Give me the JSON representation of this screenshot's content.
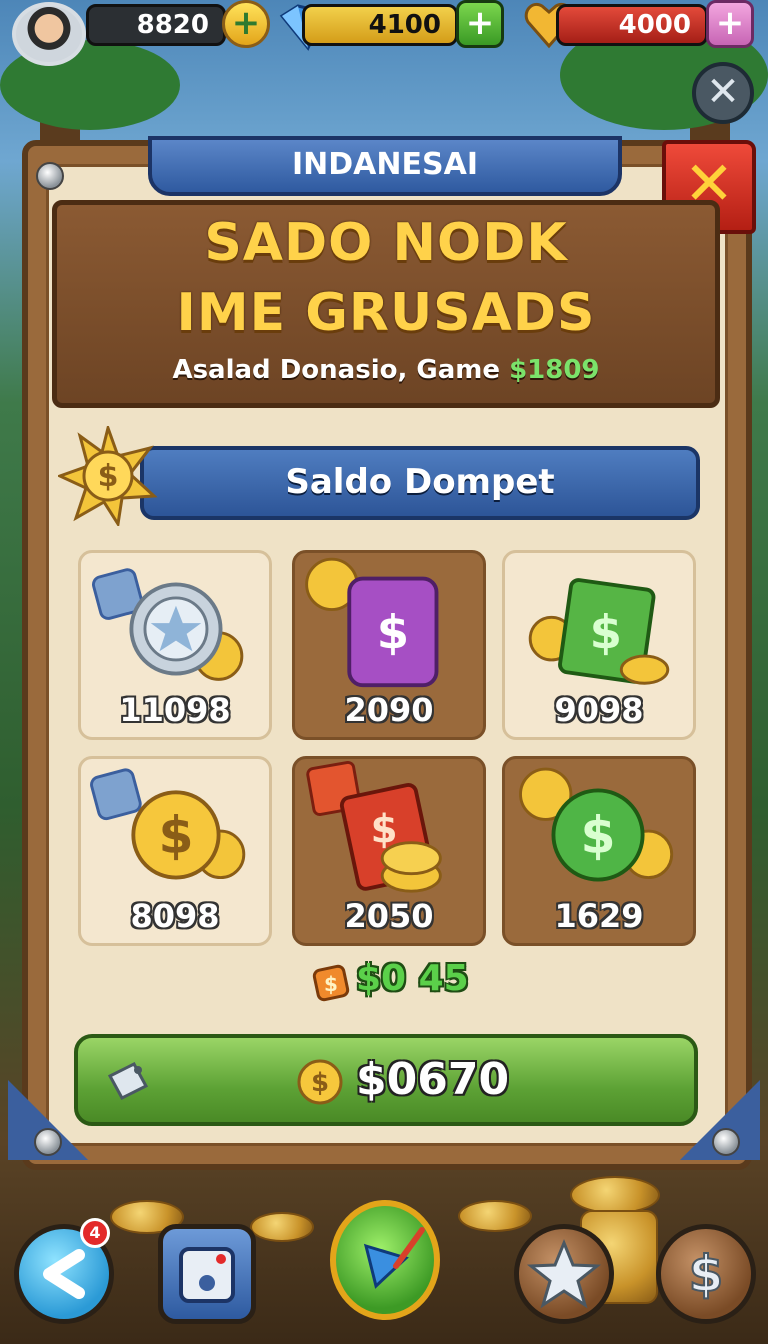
{
  "resources": {
    "coins": {
      "value": "8820",
      "icon": "coin-icon"
    },
    "gems": {
      "value": "4100",
      "icon": "diamond-icon"
    },
    "hearts": {
      "value": "4000",
      "icon": "heart-icon"
    }
  },
  "panel": {
    "ribbon_title": "INDANESAI",
    "headline_line1": "SADO NODK",
    "headline_line2": "IME GRUSADS",
    "subline_prefix": "Asalad Donasio, Game ",
    "subline_amount": "$1809",
    "wallet_label": "Saldo Dompet"
  },
  "tiles": [
    {
      "value": "11098",
      "icon": "silver-gear-coins-icon"
    },
    {
      "value": "2090",
      "icon": "purple-wallet-icon"
    },
    {
      "value": "9098",
      "icon": "green-cash-icon"
    },
    {
      "value": "8098",
      "icon": "gold-coins-icon"
    },
    {
      "value": "2050",
      "icon": "red-cash-stack-icon"
    },
    {
      "value": "1629",
      "icon": "green-coin-icon"
    }
  ],
  "price_note": "$0 45",
  "buy_button": {
    "label": "$0670"
  },
  "nav": {
    "back_badge": "4"
  },
  "colors": {
    "green_accent": "#5bd04a",
    "gold_text": "#ffd24a",
    "ribbon_blue": "#2f5aa0",
    "close_red": "#b41f14"
  }
}
